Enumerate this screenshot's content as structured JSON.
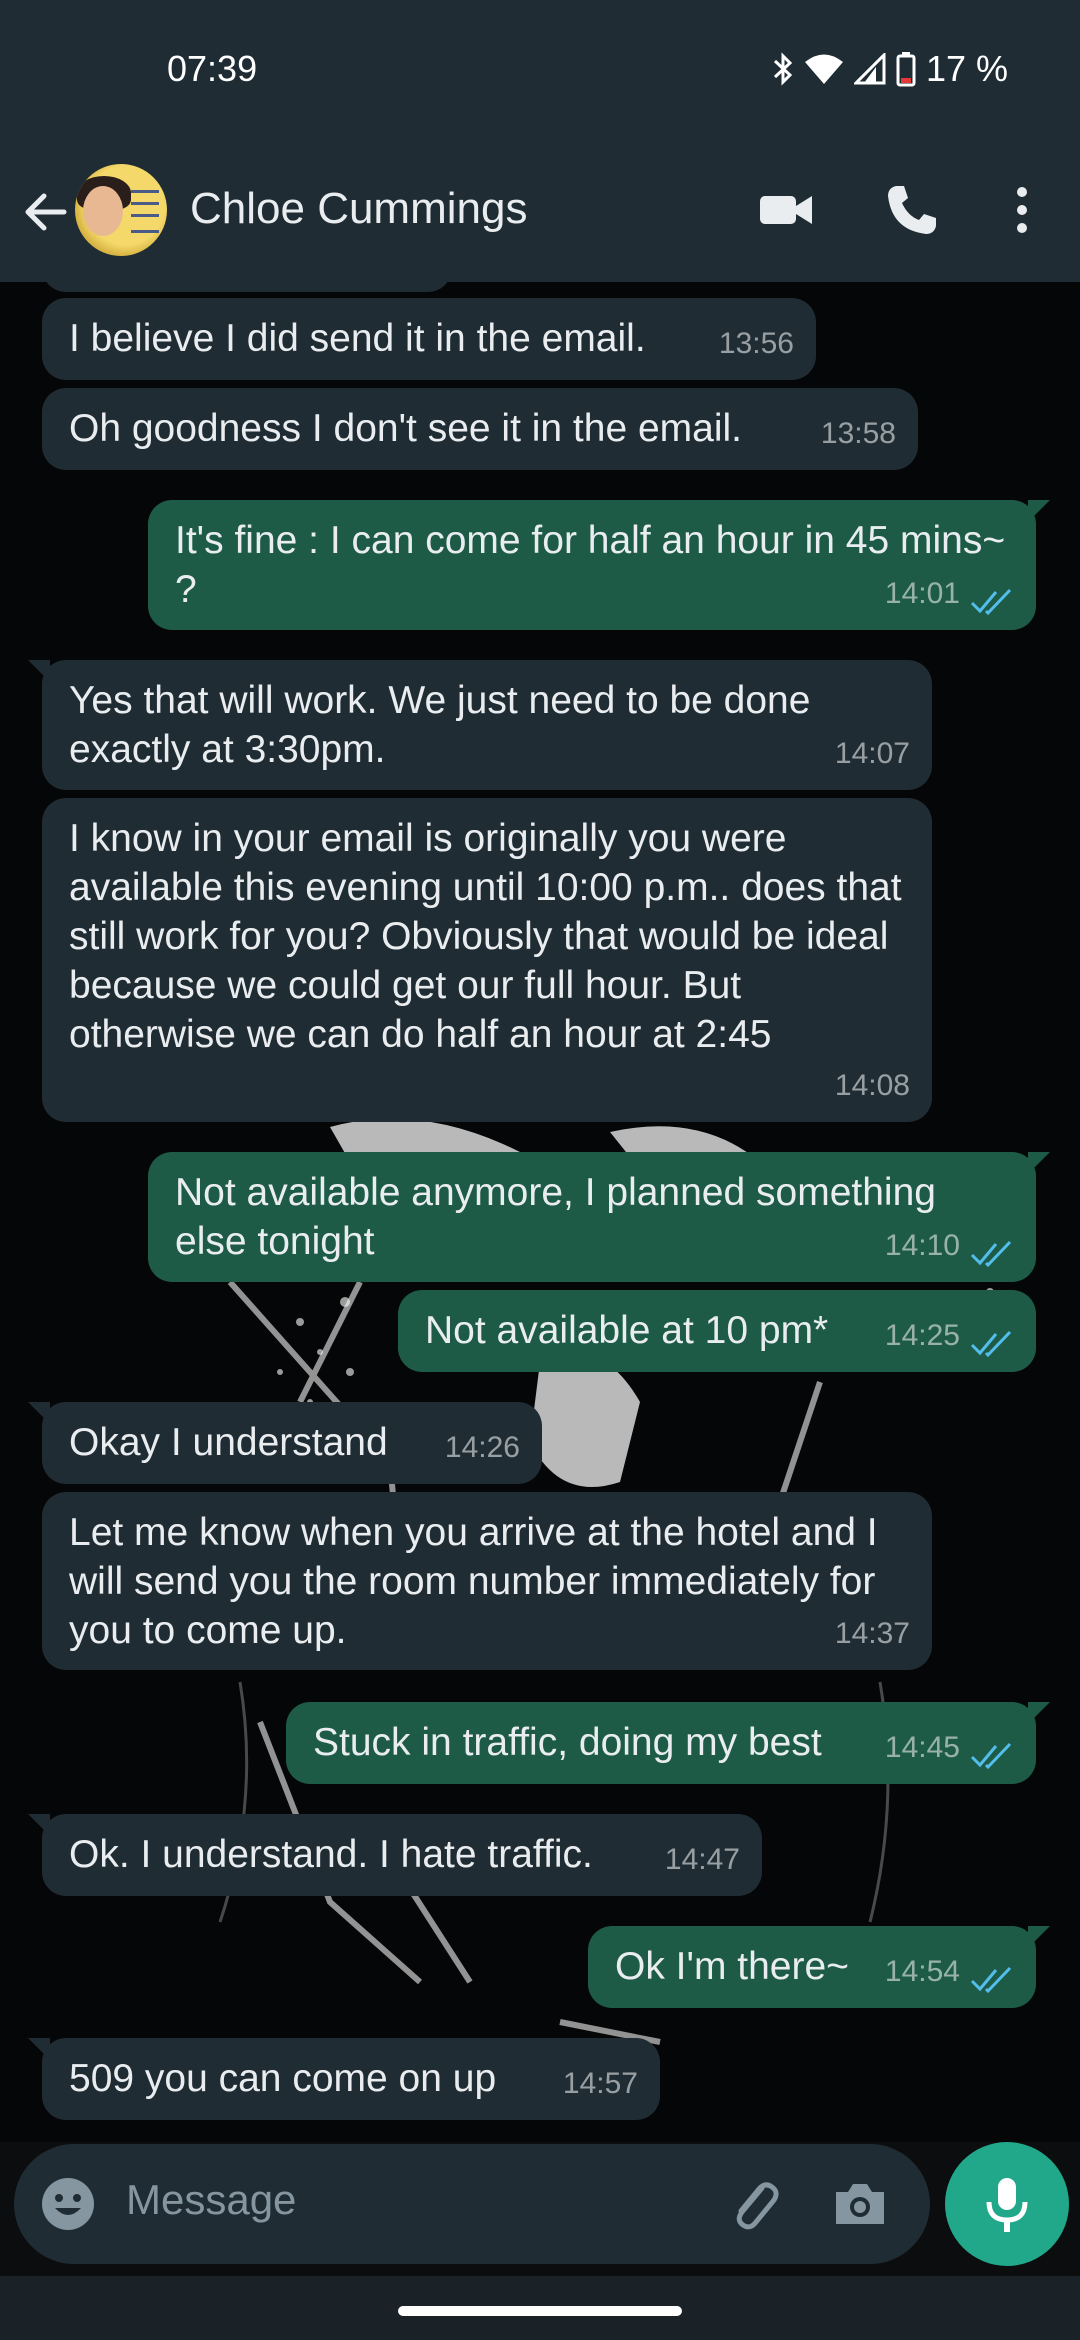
{
  "status_bar": {
    "time": "07:39",
    "battery": "17 %",
    "icons": [
      "bluetooth-icon",
      "wifi-icon",
      "signal-icon",
      "battery-icon"
    ]
  },
  "header": {
    "contact_name": "Chloe Cummings",
    "icons": [
      "back-arrow-icon",
      "avatar",
      "video-call-icon",
      "voice-call-icon",
      "more-vert-icon"
    ]
  },
  "messages": [
    {
      "direction": "in",
      "text": "I believe I did send it in the email.",
      "time": "13:56"
    },
    {
      "direction": "in",
      "text": "Oh goodness I don't see it in the email.",
      "time": "13:58"
    },
    {
      "direction": "out",
      "text": "It's fine : I can come for half an hour in 45 mins~ ?",
      "time": "14:01",
      "status": "read"
    },
    {
      "direction": "in",
      "text": "Yes that will work. We just need to be done exactly at 3:30pm.",
      "time": "14:07"
    },
    {
      "direction": "in",
      "text": "I know in your email is originally you were available this evening until 10:00 p.m.. does that still work for you? Obviously that would be ideal because we could get our full hour. But otherwise we can do half an hour at 2:45",
      "time": "14:08"
    },
    {
      "direction": "out",
      "text": "Not available anymore, I planned something else tonight",
      "time": "14:10",
      "status": "read"
    },
    {
      "direction": "out",
      "text": "Not available at 10 pm*",
      "time": "14:25",
      "status": "read"
    },
    {
      "direction": "in",
      "text": "Okay I understand",
      "time": "14:26"
    },
    {
      "direction": "in",
      "text": "Let me know when you arrive at the hotel and I will send you the room number immediately for you to come up.",
      "time": "14:37"
    },
    {
      "direction": "out",
      "text": "Stuck in traffic, doing my best",
      "time": "14:45",
      "status": "read"
    },
    {
      "direction": "in",
      "text": "Ok. I understand. I hate traffic.",
      "time": "14:47"
    },
    {
      "direction": "out",
      "text": "Ok I'm there~",
      "time": "14:54",
      "status": "read"
    },
    {
      "direction": "in",
      "text": "509 you can come on up",
      "time": "14:57"
    }
  ],
  "composer": {
    "placeholder": "Message",
    "icons": [
      "emoji-icon",
      "attach-icon",
      "camera-icon",
      "mic-icon"
    ]
  },
  "colors": {
    "header_bg": "#1f2c34",
    "incoming_bubble": "#202c33",
    "outgoing_bubble": "#1e5b46",
    "read_ticks": "#53bdeb",
    "mic_button": "#21a88a"
  }
}
